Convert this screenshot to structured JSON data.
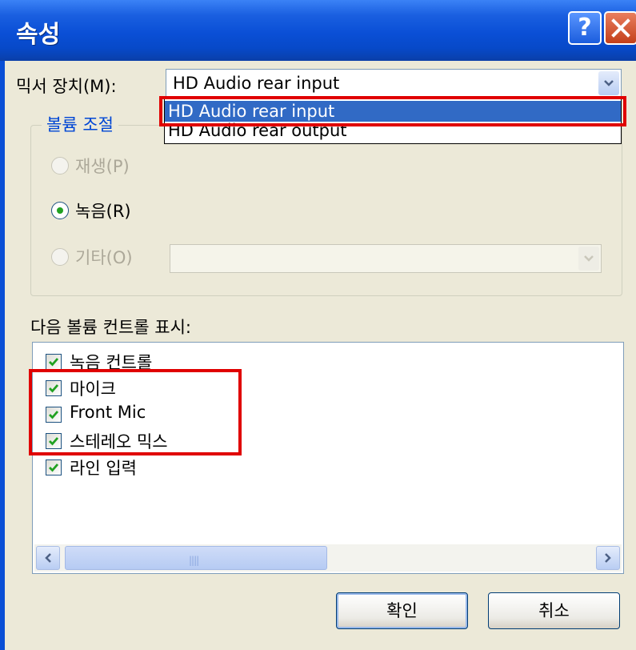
{
  "window": {
    "title": "속성",
    "help_glyph": "?"
  },
  "mixer": {
    "label": "믹서 장치(M):",
    "selected_value": "HD Audio rear input",
    "options": [
      "HD Audio rear input",
      "HD Audio rear output"
    ],
    "highlighted_option": "HD Audio rear input"
  },
  "volume_group": {
    "title": "볼륨 조절",
    "radios": [
      {
        "label": "재생(P)",
        "enabled": false,
        "checked": false
      },
      {
        "label": "녹음(R)",
        "enabled": true,
        "checked": true
      },
      {
        "label": "기타(O)",
        "enabled": false,
        "checked": false
      }
    ],
    "other_combo_value": ""
  },
  "controls": {
    "label": "다음 볼륨 컨트롤 표시:",
    "items": [
      {
        "label": "녹음 컨트롤",
        "checked": true
      },
      {
        "label": "마이크",
        "checked": true
      },
      {
        "label": "Front Mic",
        "checked": true
      },
      {
        "label": "스테레오 믹스",
        "checked": true
      },
      {
        "label": "라인 입력",
        "checked": true
      }
    ]
  },
  "buttons": {
    "ok": "확인",
    "cancel": "취소"
  },
  "colors": {
    "titlebar": "#0a4fd6",
    "highlight": "#316ac5",
    "annotation_red": "#e00000",
    "dialog_bg": "#ece9d8",
    "checkmark": "#21a121"
  }
}
